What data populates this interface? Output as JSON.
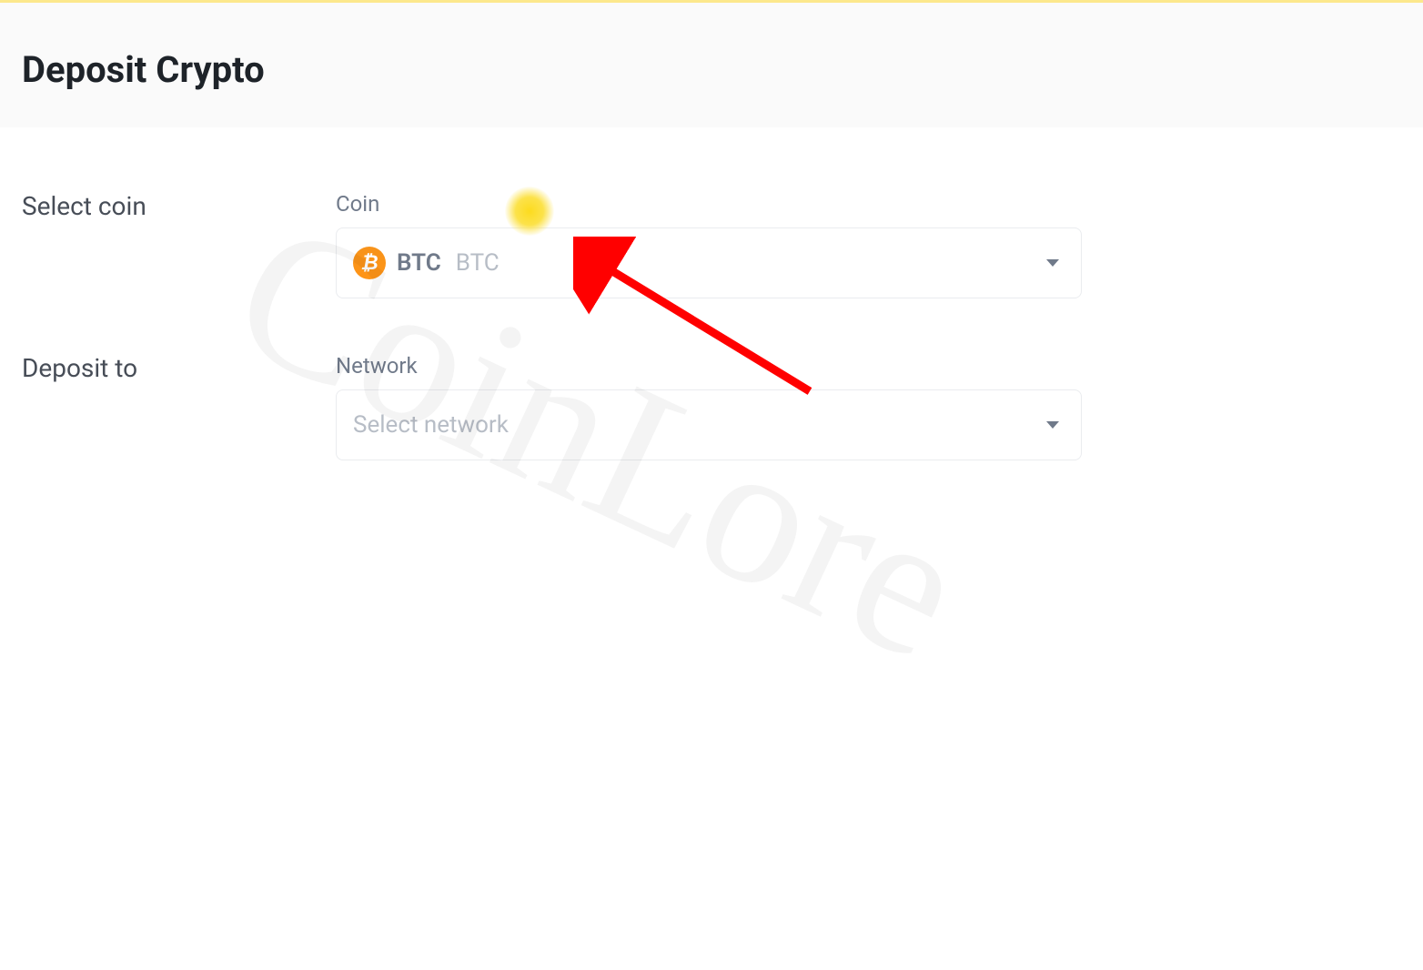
{
  "header": {
    "title": "Deposit Crypto"
  },
  "form": {
    "coin_section": {
      "row_label": "Select coin",
      "field_label": "Coin",
      "selected_ticker": "BTC",
      "selected_name": "BTC",
      "icon_name": "bitcoin-icon",
      "icon_glyph": "₿"
    },
    "network_section": {
      "row_label": "Deposit to",
      "field_label": "Network",
      "placeholder": "Select network"
    }
  },
  "annotations": {
    "highlight_dot": true,
    "arrow": true
  },
  "watermark_text": "CoinLore",
  "colors": {
    "accent": "#f7931a",
    "text_primary": "#1e2329",
    "text_secondary": "#474d57",
    "text_muted": "#707a8a",
    "text_placeholder": "#b7bdc6",
    "border": "#eaecef",
    "header_bg": "#fafafa",
    "highlight": "#fcdb1e",
    "arrow": "#ff0000"
  }
}
